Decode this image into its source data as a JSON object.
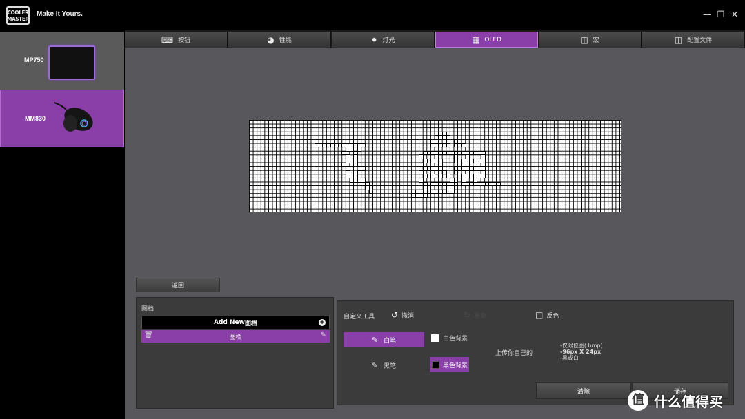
{
  "app": {
    "logo_line1": "COOLER",
    "logo_line2": "MASTER",
    "tagline": "Make It Yours."
  },
  "window_controls": [
    "minimize-icon",
    "maximize-icon",
    "close-icon"
  ],
  "devices": [
    {
      "label": "MP750",
      "selected": false
    },
    {
      "label": "MM830",
      "selected": true
    }
  ],
  "tabs": [
    {
      "label": "按钮",
      "icon": "keyboard-icon",
      "active": false
    },
    {
      "label": "性能",
      "icon": "gauge-icon",
      "active": false
    },
    {
      "label": "灯光",
      "icon": "bulb-icon",
      "active": false
    },
    {
      "label": "OLED",
      "icon": "oled-icon",
      "active": true
    },
    {
      "label": "宏",
      "icon": "macro-icon",
      "active": false
    },
    {
      "label": "配置文件",
      "icon": "profile-icon",
      "active": false
    }
  ],
  "oled": {
    "resolution": "96x24",
    "pixels_on": [
      [
        17,
        6
      ],
      [
        18,
        6
      ],
      [
        19,
        6
      ],
      [
        20,
        6
      ],
      [
        21,
        6
      ],
      [
        22,
        6
      ],
      [
        23,
        6
      ],
      [
        24,
        6
      ],
      [
        25,
        6
      ],
      [
        26,
        6
      ],
      [
        27,
        6
      ],
      [
        28,
        6
      ],
      [
        29,
        6
      ],
      [
        25,
        7
      ],
      [
        26,
        7
      ],
      [
        28,
        7
      ],
      [
        24,
        8
      ],
      [
        27,
        8
      ],
      [
        25,
        9
      ],
      [
        27,
        9
      ],
      [
        25,
        10
      ],
      [
        26,
        10
      ],
      [
        27,
        10
      ],
      [
        24,
        11
      ],
      [
        28,
        11
      ],
      [
        25,
        12
      ],
      [
        29,
        12
      ],
      [
        25,
        13
      ],
      [
        28,
        13
      ],
      [
        25,
        14
      ],
      [
        26,
        14
      ],
      [
        27,
        14
      ],
      [
        26,
        15
      ],
      [
        27,
        15
      ],
      [
        28,
        15
      ],
      [
        29,
        15
      ],
      [
        29,
        16
      ],
      [
        30,
        16
      ],
      [
        30,
        17
      ],
      [
        31,
        17
      ],
      [
        31,
        18
      ],
      [
        49,
        3
      ],
      [
        50,
        3
      ],
      [
        48,
        4
      ],
      [
        49,
        4
      ],
      [
        50,
        4
      ],
      [
        51,
        4
      ],
      [
        47,
        5
      ],
      [
        51,
        5
      ],
      [
        53,
        5
      ],
      [
        47,
        6
      ],
      [
        48,
        6
      ],
      [
        49,
        6
      ],
      [
        50,
        6
      ],
      [
        51,
        6
      ],
      [
        53,
        6
      ],
      [
        54,
        6
      ],
      [
        55,
        6
      ],
      [
        45,
        8
      ],
      [
        46,
        8
      ],
      [
        47,
        8
      ],
      [
        48,
        8
      ],
      [
        49,
        8
      ],
      [
        50,
        8
      ],
      [
        51,
        8
      ],
      [
        52,
        8
      ],
      [
        53,
        8
      ],
      [
        54,
        8
      ],
      [
        55,
        8
      ],
      [
        56,
        8
      ],
      [
        57,
        8
      ],
      [
        58,
        8
      ],
      [
        59,
        8
      ],
      [
        60,
        8
      ],
      [
        44,
        9
      ],
      [
        48,
        9
      ],
      [
        53,
        9
      ],
      [
        56,
        9
      ],
      [
        60,
        9
      ],
      [
        45,
        10
      ],
      [
        46,
        10
      ],
      [
        47,
        10
      ],
      [
        48,
        10
      ],
      [
        49,
        10
      ],
      [
        53,
        10
      ],
      [
        54,
        10
      ],
      [
        55,
        10
      ],
      [
        56,
        10
      ],
      [
        57,
        10
      ],
      [
        58,
        10
      ],
      [
        59,
        10
      ],
      [
        60,
        10
      ],
      [
        44,
        11
      ],
      [
        49,
        11
      ],
      [
        55,
        11
      ],
      [
        56,
        11
      ],
      [
        60,
        11
      ],
      [
        45,
        12
      ],
      [
        46,
        12
      ],
      [
        47,
        12
      ],
      [
        48,
        12
      ],
      [
        49,
        12
      ],
      [
        53,
        12
      ],
      [
        54,
        12
      ],
      [
        55,
        12
      ],
      [
        56,
        12
      ],
      [
        57,
        12
      ],
      [
        58,
        12
      ],
      [
        59,
        12
      ],
      [
        60,
        12
      ],
      [
        44,
        13
      ],
      [
        48,
        13
      ],
      [
        50,
        13
      ],
      [
        53,
        13
      ],
      [
        56,
        13
      ],
      [
        60,
        13
      ],
      [
        45,
        14
      ],
      [
        46,
        14
      ],
      [
        47,
        14
      ],
      [
        49,
        14
      ],
      [
        51,
        14
      ],
      [
        54,
        14
      ],
      [
        55,
        14
      ],
      [
        56,
        14
      ],
      [
        57,
        14
      ],
      [
        58,
        14
      ],
      [
        59,
        14
      ],
      [
        60,
        14
      ],
      [
        44,
        15
      ],
      [
        52,
        15
      ],
      [
        53,
        15
      ],
      [
        55,
        15
      ],
      [
        58,
        15
      ],
      [
        45,
        16
      ],
      [
        47,
        16
      ],
      [
        48,
        16
      ],
      [
        49,
        16
      ],
      [
        50,
        16
      ],
      [
        51,
        16
      ],
      [
        52,
        16
      ],
      [
        53,
        16
      ],
      [
        55,
        16
      ],
      [
        56,
        16
      ],
      [
        57,
        16
      ],
      [
        58,
        16
      ],
      [
        59,
        16
      ],
      [
        60,
        16
      ],
      [
        61,
        16
      ],
      [
        62,
        16
      ],
      [
        63,
        16
      ],
      [
        64,
        16
      ],
      [
        45,
        17
      ],
      [
        46,
        17
      ],
      [
        51,
        17
      ],
      [
        52,
        17
      ],
      [
        43,
        18
      ],
      [
        44,
        18
      ],
      [
        45,
        18
      ],
      [
        46,
        18
      ],
      [
        47,
        18
      ],
      [
        48,
        18
      ],
      [
        49,
        18
      ],
      [
        50,
        18
      ],
      [
        51,
        18
      ],
      [
        52,
        18
      ],
      [
        42,
        19
      ],
      [
        43,
        19
      ],
      [
        44,
        19
      ],
      [
        45,
        19
      ]
    ]
  },
  "back_label": "返回",
  "files": {
    "title": "图档",
    "add_new_bold": "Add New",
    "add_new_rest": " 图档",
    "items": [
      {
        "label": "图档"
      }
    ]
  },
  "tools": {
    "title": "自定义工具",
    "undo": "撤消",
    "redo": "重复",
    "invert": "反色",
    "white_pen": "白笔",
    "black_pen": "黑笔",
    "white_bg": "白色背景",
    "black_bg": "黑色背景",
    "upload": "上传你自己的",
    "req1": "-仅限位图(.bmp)",
    "req2": "-96px X 24px",
    "req3": "-黑或白",
    "clear": "清除",
    "save": "储存"
  },
  "watermark": {
    "logo": "值",
    "text": "什么值得买"
  },
  "colors": {
    "accent": "#8a3ea8",
    "panel": "#3b3b3b",
    "main_bg": "#58575b"
  }
}
